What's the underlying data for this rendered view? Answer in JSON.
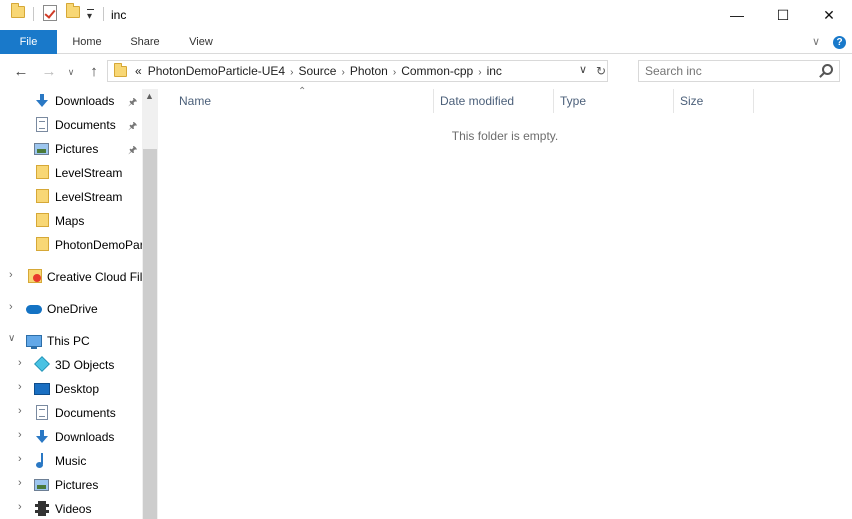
{
  "window": {
    "title": "inc",
    "minimize_glyph": "—",
    "maximize_glyph": "☐",
    "close_glyph": "✕"
  },
  "ribbon": {
    "file": "File",
    "home": "Home",
    "share": "Share",
    "view": "View",
    "expand_glyph": "∨",
    "help_glyph": "?"
  },
  "address": {
    "overflow": "«",
    "crumbs": [
      "PhotonDemoParticle-UE4",
      "Source",
      "Photon",
      "Common-cpp",
      "inc"
    ],
    "separator": "›"
  },
  "search": {
    "placeholder": "Search inc"
  },
  "nav": {
    "quick_access": [
      {
        "label": "Downloads",
        "icon": "download-icon",
        "pinned": true
      },
      {
        "label": "Documents",
        "icon": "documents-icon",
        "pinned": true
      },
      {
        "label": "Pictures",
        "icon": "pictures-icon",
        "pinned": true
      },
      {
        "label": "LevelStream",
        "icon": "folder-icon",
        "pinned": false
      },
      {
        "label": "LevelStream",
        "icon": "folder-icon",
        "pinned": false
      },
      {
        "label": "Maps",
        "icon": "folder-icon",
        "pinned": false
      },
      {
        "label": "PhotonDemoPar",
        "icon": "folder-icon",
        "pinned": false
      }
    ],
    "creative_cloud": "Creative Cloud Fil",
    "onedrive": "OneDrive",
    "this_pc": "This PC",
    "this_pc_items": [
      {
        "label": "3D Objects",
        "icon": "3d-objects-icon"
      },
      {
        "label": "Desktop",
        "icon": "desktop-icon"
      },
      {
        "label": "Documents",
        "icon": "documents-icon"
      },
      {
        "label": "Downloads",
        "icon": "download-icon"
      },
      {
        "label": "Music",
        "icon": "music-icon"
      },
      {
        "label": "Pictures",
        "icon": "pictures-icon"
      },
      {
        "label": "Videos",
        "icon": "videos-icon"
      }
    ]
  },
  "columns": {
    "name": "Name",
    "date_modified": "Date modified",
    "type": "Type",
    "size": "Size"
  },
  "empty_message": "This folder is empty.",
  "colors": {
    "accent": "#1979ca",
    "column_header": "#4c607a"
  }
}
